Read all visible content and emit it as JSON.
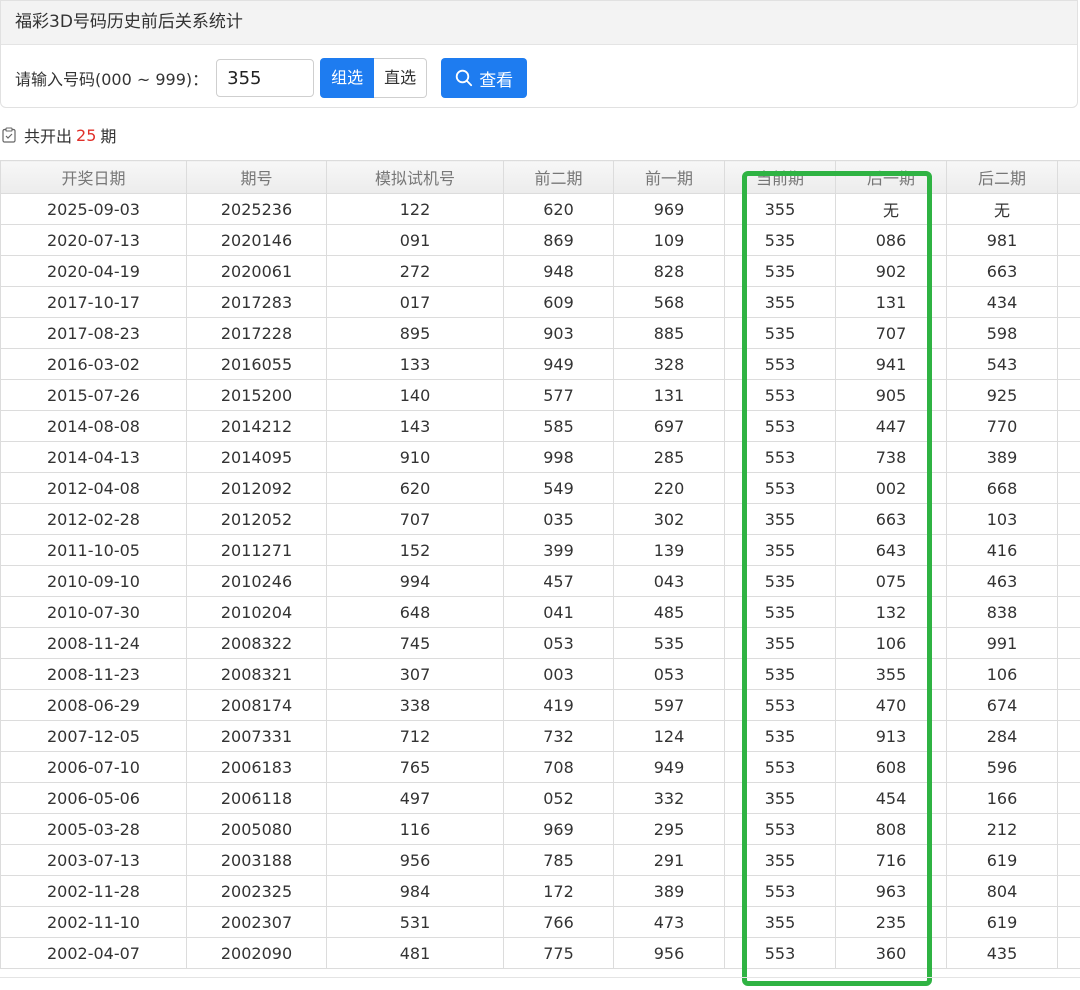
{
  "panel": {
    "title": "福彩3D号码历史前后关系统计"
  },
  "query": {
    "label": "请输入号码(000 ~ 999)：",
    "value": "355",
    "mode_group": "组选",
    "mode_direct": "直选",
    "search_label": "查看"
  },
  "summary": {
    "prefix": "共开出",
    "count": "25",
    "suffix": "期"
  },
  "colors": {
    "primary": "#1e7cf0",
    "count_red": "#e0302a",
    "highlight_green": "#2fb343"
  },
  "table": {
    "columns": [
      "开奖日期",
      "期号",
      "模拟试机号",
      "前二期",
      "前一期",
      "当前期",
      "后一期",
      "后二期"
    ],
    "rows": [
      [
        "2025-09-03",
        "2025236",
        "122",
        "620",
        "969",
        "355",
        "无",
        "无"
      ],
      [
        "2020-07-13",
        "2020146",
        "091",
        "869",
        "109",
        "535",
        "086",
        "981"
      ],
      [
        "2020-04-19",
        "2020061",
        "272",
        "948",
        "828",
        "535",
        "902",
        "663"
      ],
      [
        "2017-10-17",
        "2017283",
        "017",
        "609",
        "568",
        "355",
        "131",
        "434"
      ],
      [
        "2017-08-23",
        "2017228",
        "895",
        "903",
        "885",
        "535",
        "707",
        "598"
      ],
      [
        "2016-03-02",
        "2016055",
        "133",
        "949",
        "328",
        "553",
        "941",
        "543"
      ],
      [
        "2015-07-26",
        "2015200",
        "140",
        "577",
        "131",
        "553",
        "905",
        "925"
      ],
      [
        "2014-08-08",
        "2014212",
        "143",
        "585",
        "697",
        "553",
        "447",
        "770"
      ],
      [
        "2014-04-13",
        "2014095",
        "910",
        "998",
        "285",
        "553",
        "738",
        "389"
      ],
      [
        "2012-04-08",
        "2012092",
        "620",
        "549",
        "220",
        "553",
        "002",
        "668"
      ],
      [
        "2012-02-28",
        "2012052",
        "707",
        "035",
        "302",
        "355",
        "663",
        "103"
      ],
      [
        "2011-10-05",
        "2011271",
        "152",
        "399",
        "139",
        "355",
        "643",
        "416"
      ],
      [
        "2010-09-10",
        "2010246",
        "994",
        "457",
        "043",
        "535",
        "075",
        "463"
      ],
      [
        "2010-07-30",
        "2010204",
        "648",
        "041",
        "485",
        "535",
        "132",
        "838"
      ],
      [
        "2008-11-24",
        "2008322",
        "745",
        "053",
        "535",
        "355",
        "106",
        "991"
      ],
      [
        "2008-11-23",
        "2008321",
        "307",
        "003",
        "053",
        "535",
        "355",
        "106"
      ],
      [
        "2008-06-29",
        "2008174",
        "338",
        "419",
        "597",
        "553",
        "470",
        "674"
      ],
      [
        "2007-12-05",
        "2007331",
        "712",
        "732",
        "124",
        "535",
        "913",
        "284"
      ],
      [
        "2006-07-10",
        "2006183",
        "765",
        "708",
        "949",
        "553",
        "608",
        "596"
      ],
      [
        "2006-05-06",
        "2006118",
        "497",
        "052",
        "332",
        "355",
        "454",
        "166"
      ],
      [
        "2005-03-28",
        "2005080",
        "116",
        "969",
        "295",
        "553",
        "808",
        "212"
      ],
      [
        "2003-07-13",
        "2003188",
        "956",
        "785",
        "291",
        "355",
        "716",
        "619"
      ],
      [
        "2002-11-28",
        "2002325",
        "984",
        "172",
        "389",
        "553",
        "963",
        "804"
      ],
      [
        "2002-11-10",
        "2002307",
        "531",
        "766",
        "473",
        "355",
        "235",
        "619"
      ],
      [
        "2002-04-07",
        "2002090",
        "481",
        "775",
        "956",
        "553",
        "360",
        "435"
      ]
    ]
  }
}
